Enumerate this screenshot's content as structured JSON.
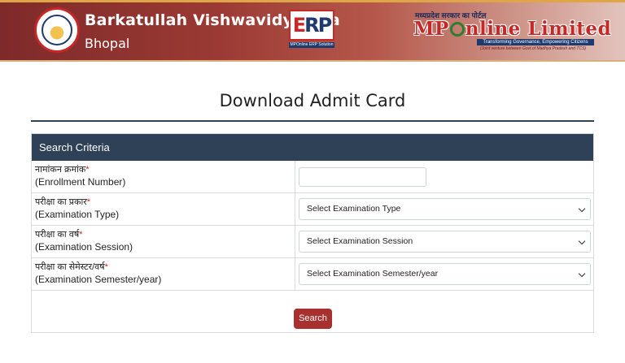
{
  "header": {
    "university_name": "Barkatullah Vishwavidyalaya",
    "university_city": "Bhopal",
    "erp_logo": {
      "letters_e": "E",
      "letters_rp": "RP",
      "tagline": "MPOnline ERP Solution"
    },
    "mponline": {
      "hindi_line": "मध्यप्रदेश सरकार का पोर्टल",
      "title_left": "MP",
      "title_right": "nline Limited",
      "tagline": "Transforming Governance, Empowering Citizens",
      "sub": "(Joint venture between Govt.of Madhya Pradesh and TCS)"
    },
    "colors": {
      "header_bg": "#9b3a34",
      "accent_red": "#c62828",
      "navy": "#1e3a6e"
    }
  },
  "page": {
    "title": "Download Admit Card"
  },
  "panel": {
    "heading": "Search Criteria",
    "heading_bg": "#2f4156",
    "fields": [
      {
        "hindi": "नामांकन क्रमांक",
        "required": "*",
        "english": "(Enrollment Number)",
        "control": "text",
        "value": ""
      },
      {
        "hindi": "परीक्षा का प्रकार",
        "required": "*",
        "english": "(Examination Type)",
        "control": "select",
        "selected": "Select Examination Type"
      },
      {
        "hindi": "परीक्षा का वर्ष",
        "required": "*",
        "english": "(Examination Session)",
        "control": "select",
        "selected": "Select Examination Session"
      },
      {
        "hindi": "परीक्षा का सेमेस्टर/वर्ष",
        "required": "*",
        "english": "(Examination Semester/year)",
        "control": "select",
        "selected": "Select Examination Semester/year"
      }
    ],
    "search_button": "Search",
    "button_color": "#a8312f"
  },
  "icons": [
    "university-seal-icon",
    "chevron-down-icon"
  ]
}
